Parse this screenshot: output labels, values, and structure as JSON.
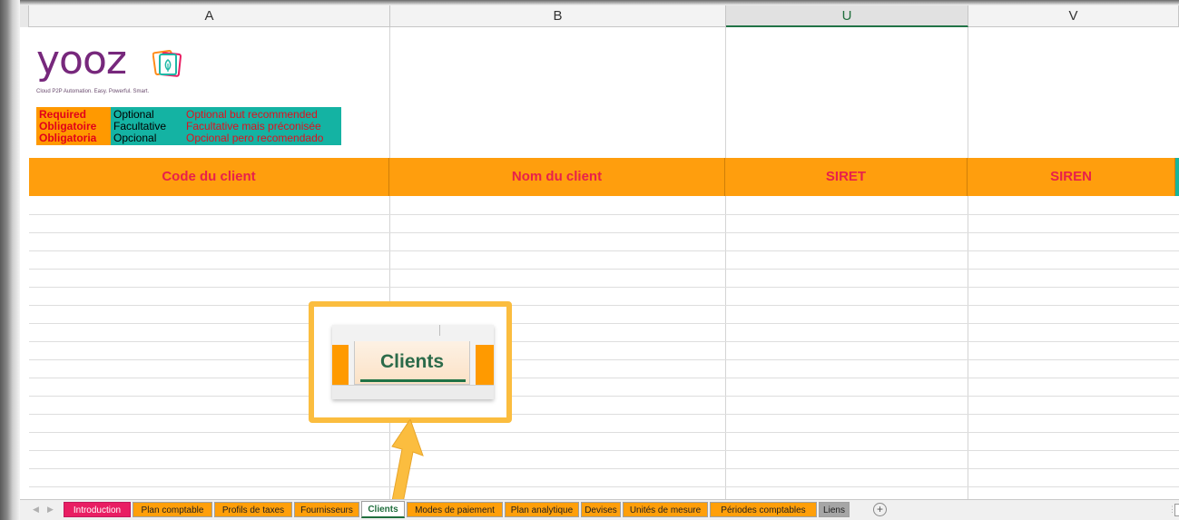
{
  "columns": [
    {
      "label": "A"
    },
    {
      "label": "B"
    },
    {
      "label": "U"
    },
    {
      "label": "V"
    }
  ],
  "logo": {
    "wordmark": "yooz",
    "tagline": "Cloud P2P Automation. Easy. Powerful. Smart."
  },
  "legend": {
    "rows": [
      {
        "required": "Required",
        "optional": "Optional",
        "recommended": "Optional but recommended"
      },
      {
        "required": "Obligatoire",
        "optional": "Facultative",
        "recommended": "Facultative mais préconisée"
      },
      {
        "required": "Obligatoria",
        "optional": "Opcional",
        "recommended": "Opcional pero recomendado"
      }
    ]
  },
  "header_row": [
    {
      "label": "Code du client"
    },
    {
      "label": "Nom du client"
    },
    {
      "label": "SIRET"
    },
    {
      "label": "SIREN"
    }
  ],
  "callout": {
    "tab_label": "Clients"
  },
  "sheet_tabs": [
    {
      "label": "Introduction",
      "style": "intro"
    },
    {
      "label": "Plan comptable",
      "style": "org"
    },
    {
      "label": "Profils de taxes",
      "style": "org"
    },
    {
      "label": "Fournisseurs",
      "style": "org"
    },
    {
      "label": "Clients",
      "style": "active"
    },
    {
      "label": "Modes de paiement",
      "style": "org"
    },
    {
      "label": "Plan analytique",
      "style": "org"
    },
    {
      "label": "Devises",
      "style": "org"
    },
    {
      "label": "Unités de mesure",
      "style": "org"
    },
    {
      "label": "Périodes comptables",
      "style": "org"
    },
    {
      "label": "Liens",
      "style": "gray"
    }
  ],
  "add_sheet_symbol": "+",
  "colors": {
    "header_orange": "#ff9e0d",
    "header_text": "#e8204b",
    "teal": "#14b3a3",
    "brand_purple": "#77287c",
    "excel_green": "#217346",
    "callout_yellow": "#fbbd3f"
  }
}
